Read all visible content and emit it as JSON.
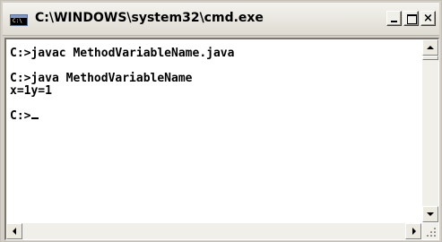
{
  "window": {
    "title": "C:\\WINDOWS\\system32\\cmd.exe",
    "icon": "cmd-console-icon",
    "icon_text": "C:\\",
    "buttons": {
      "minimize": "_",
      "maximize": "□",
      "close": "×"
    }
  },
  "console": {
    "lines": [
      "C:>javac MethodVariableName.java",
      "",
      "C:>java MethodVariableName",
      "x=1y=1",
      "",
      "C:>"
    ],
    "foreground": "#000000",
    "background": "#ffffff"
  },
  "colors": {
    "frame": "#d4d0c8",
    "titlebar": "#f4f3ee"
  }
}
